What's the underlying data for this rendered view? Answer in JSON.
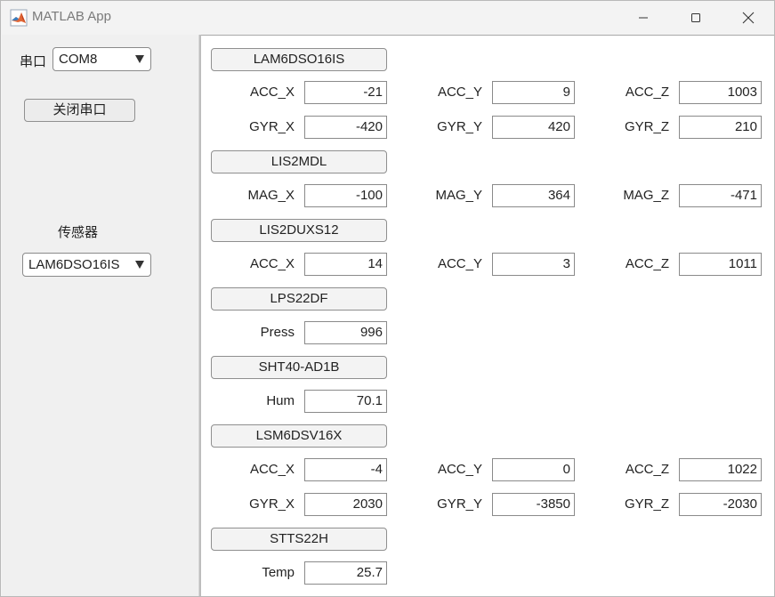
{
  "window": {
    "title": "MATLAB App"
  },
  "left": {
    "port_label": "串口",
    "port_value": "COM8",
    "close_port_button": "关闭串口",
    "sensor_label": "传感器",
    "sensor_value": "LAM6DSO16IS"
  },
  "sections": {
    "lam6dso16is": {
      "title": "LAM6DSO16IS",
      "acc_x_label": "ACC_X",
      "acc_x": "-21",
      "acc_y_label": "ACC_Y",
      "acc_y": "9",
      "acc_z_label": "ACC_Z",
      "acc_z": "1003",
      "gyr_x_label": "GYR_X",
      "gyr_x": "-420",
      "gyr_y_label": "GYR_Y",
      "gyr_y": "420",
      "gyr_z_label": "GYR_Z",
      "gyr_z": "210"
    },
    "lis2mdl": {
      "title": "LIS2MDL",
      "mag_x_label": "MAG_X",
      "mag_x": "-100",
      "mag_y_label": "MAG_Y",
      "mag_y": "364",
      "mag_z_label": "MAG_Z",
      "mag_z": "-471"
    },
    "lis2duxs12": {
      "title": "LIS2DUXS12",
      "acc_x_label": "ACC_X",
      "acc_x": "14",
      "acc_y_label": "ACC_Y",
      "acc_y": "3",
      "acc_z_label": "ACC_Z",
      "acc_z": "1011"
    },
    "lps22df": {
      "title": "LPS22DF",
      "press_label": "Press",
      "press": "996"
    },
    "sht40": {
      "title": "SHT40-AD1B",
      "hum_label": "Hum",
      "hum": "70.1"
    },
    "lsm6dsv16x": {
      "title": "LSM6DSV16X",
      "acc_x_label": "ACC_X",
      "acc_x": "-4",
      "acc_y_label": "ACC_Y",
      "acc_y": "0",
      "acc_z_label": "ACC_Z",
      "acc_z": "1022",
      "gyr_x_label": "GYR_X",
      "gyr_x": "2030",
      "gyr_y_label": "GYR_Y",
      "gyr_y": "-3850",
      "gyr_z_label": "GYR_Z",
      "gyr_z": "-2030"
    },
    "stts22h": {
      "title": "STTS22H",
      "temp_label": "Temp",
      "temp": "25.7"
    }
  },
  "icons": {
    "app": "matlab-logo-icon",
    "minimize": "minimize-icon",
    "maximize": "maximize-icon",
    "close": "close-icon",
    "dropdown": "caret-down-icon"
  },
  "colors": {
    "window_bg": "#f3f3f3",
    "panel_bg": "#f0f0f0",
    "content_bg": "#ffffff",
    "border": "#8a8a8a",
    "matlab_orange": "#e16737"
  }
}
